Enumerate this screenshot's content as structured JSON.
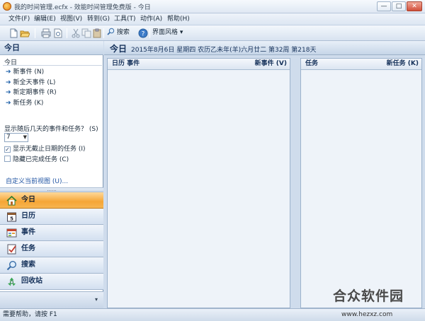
{
  "window": {
    "title": "我的时间管理.ecfx - 效能时间管理免费版 - 今日",
    "minimize_label": "—",
    "maximize_label": "□",
    "close_label": "✕"
  },
  "menu": {
    "items": [
      "文件(F)",
      "编辑(E)",
      "视图(V)",
      "转到(G)",
      "工具(T)",
      "动作(A)",
      "帮助(H)"
    ]
  },
  "toolbar": {
    "search_label": "搜索",
    "style_label": "界面风格",
    "style_arrow": "▾",
    "icons": [
      "new-document-icon",
      "open-folder-icon",
      "print-icon",
      "print-preview-icon",
      "cut-icon",
      "copy-icon",
      "paste-icon",
      "search-icon",
      "help-icon"
    ]
  },
  "sidebar": {
    "header": "今日",
    "subtitle": "今日",
    "quick_items": [
      {
        "label": "新事件 (N)"
      },
      {
        "label": "新全天事件 (L)"
      },
      {
        "label": "新定期事件 (R)"
      },
      {
        "label": "新任务 (K)"
      }
    ],
    "days_label": "显示随后几天的事件和任务？ (S)",
    "days_value": "7",
    "show_no_deadline": {
      "label": "显示无截止日期的任务 (I)",
      "checked": true
    },
    "hide_completed": {
      "label": "隐藏已完成任务 (C)",
      "checked": false
    },
    "custom_view": "自定义当前视图 (U)...",
    "splitter": "......",
    "nav": [
      {
        "label": "今日",
        "icon": "home-icon",
        "active": true
      },
      {
        "label": "日历",
        "icon": "calendar-icon",
        "active": false
      },
      {
        "label": "事件",
        "icon": "event-icon",
        "active": false
      },
      {
        "label": "任务",
        "icon": "task-icon",
        "active": false
      },
      {
        "label": "搜索",
        "icon": "search-icon",
        "active": false
      },
      {
        "label": "回收站",
        "icon": "recycle-bin-icon",
        "active": false
      }
    ],
    "config_label": "▾"
  },
  "main": {
    "title": "今日",
    "date_line": "2015年8月6日 星期四 农历乙未年(羊)六月廿二 第32周 第218天",
    "calendar_pane": {
      "header_left": "日历 事件",
      "header_right": "新事件 (V)"
    },
    "task_pane": {
      "header_left": "任务",
      "header_right": "新任务 (K)"
    }
  },
  "status": {
    "text": "需要帮助，请按 F1",
    "watermark_text": "www.hezxz.com",
    "watermark_logo": "合众软件园"
  },
  "colors": {
    "accent_orange": "#f5a536",
    "header_blue": "#15315a",
    "link_blue": "#2155a3"
  }
}
